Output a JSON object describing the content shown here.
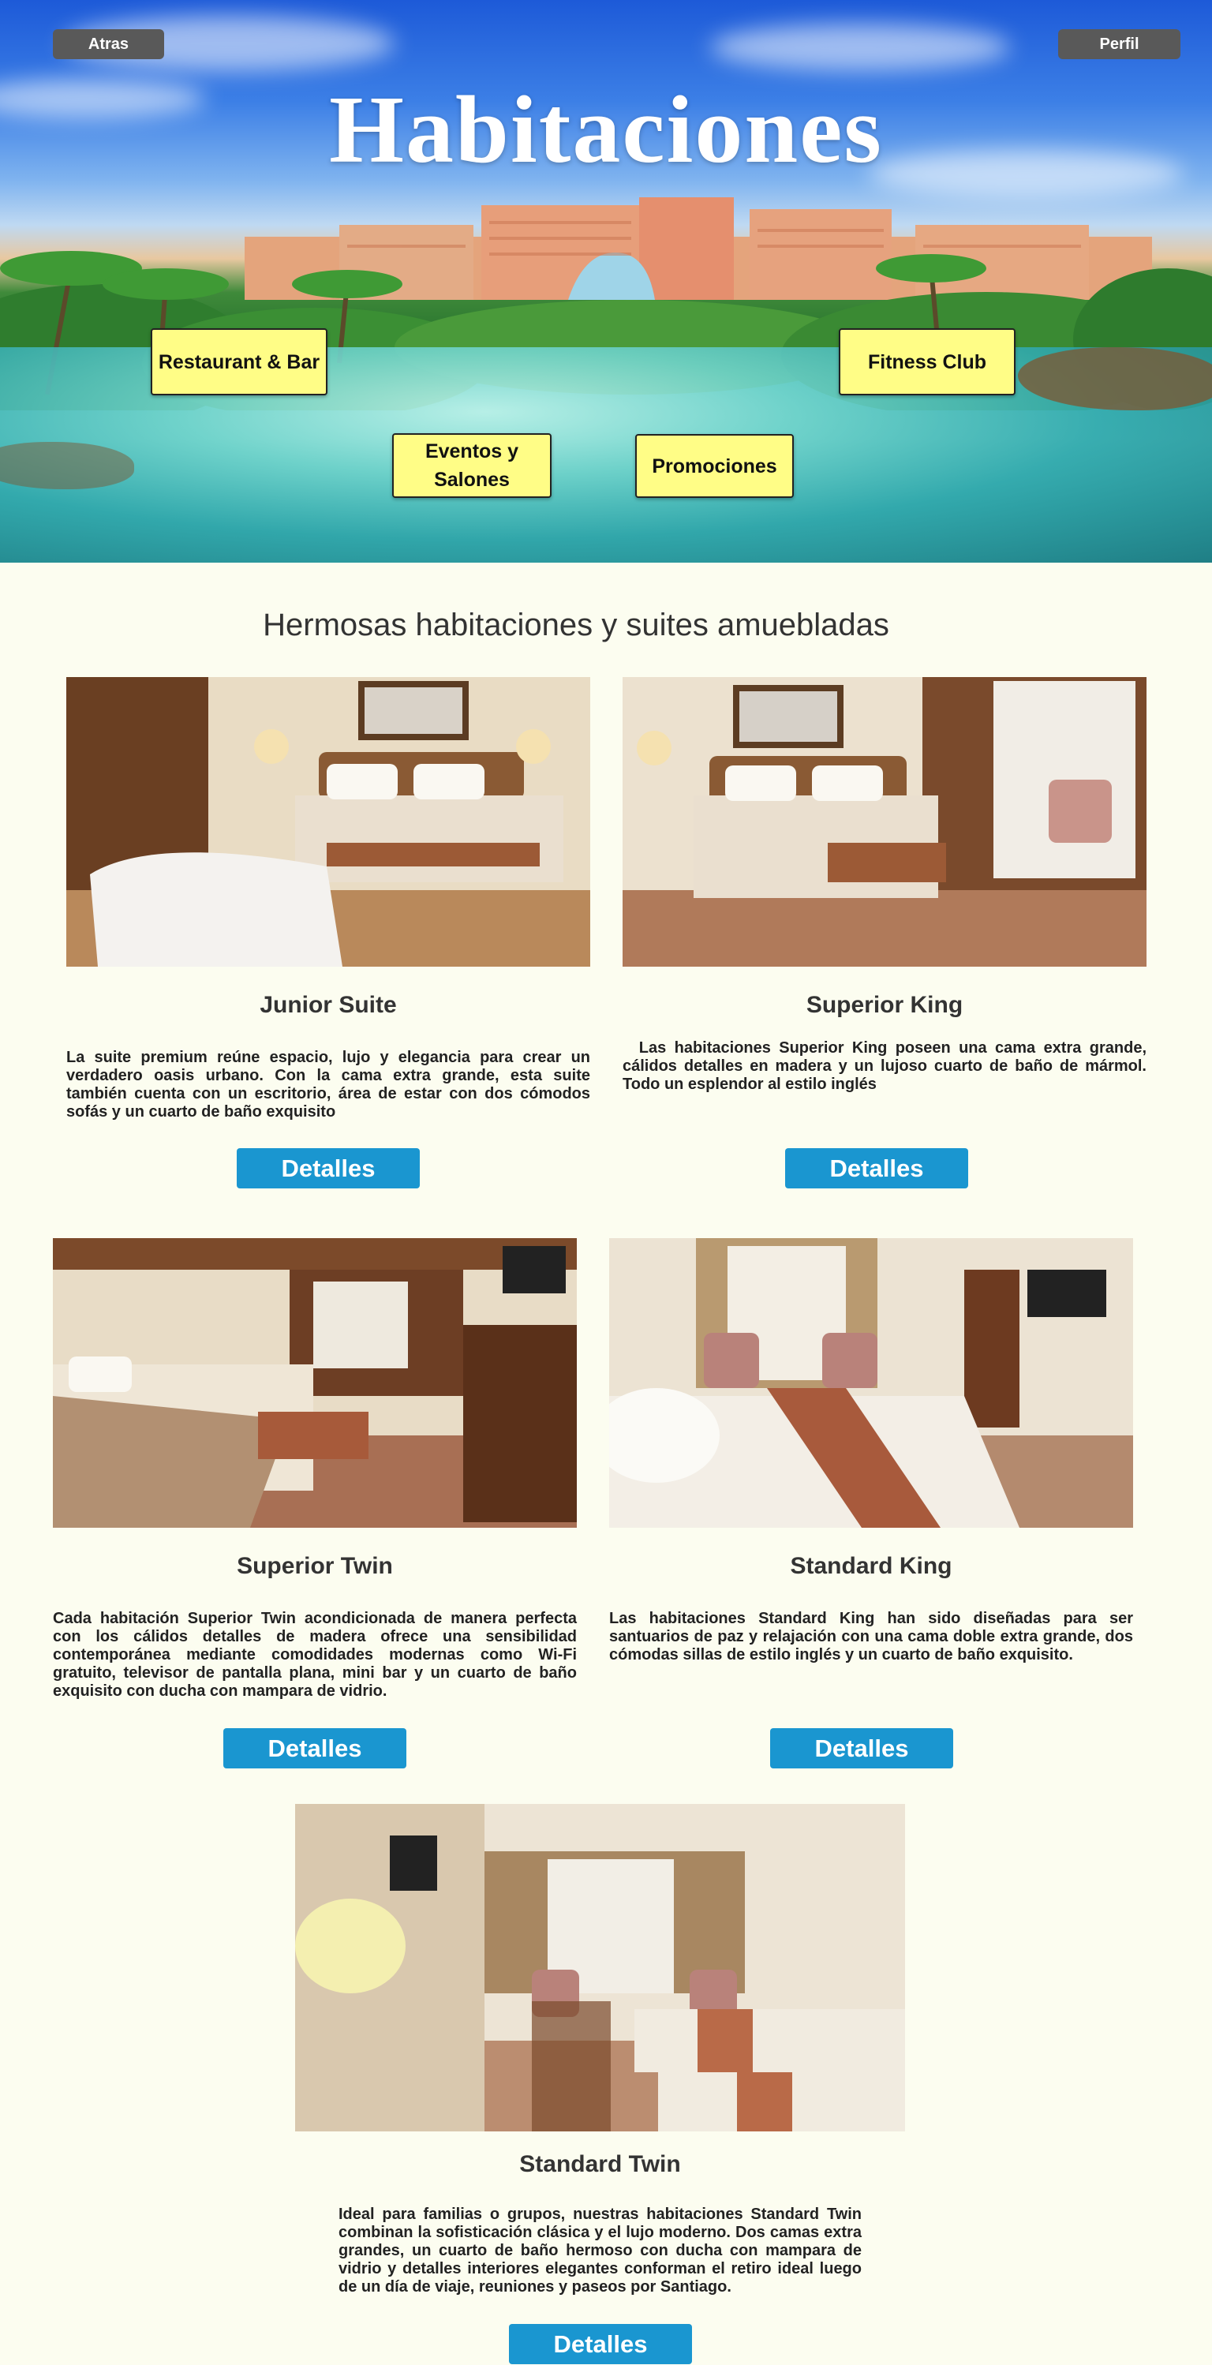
{
  "header": {
    "back_label": "Atras",
    "profile_label": "Perfil",
    "title": "Habitaciones"
  },
  "nav": [
    {
      "label": "Restaurant & Bar"
    },
    {
      "label": "Fitness Club"
    },
    {
      "label": "Eventos y Salones"
    },
    {
      "label": "Promociones"
    }
  ],
  "section_title": "Hermosas habitaciones y suites amuebladas",
  "rooms": [
    {
      "name": "Junior Suite",
      "description": "La suite premium reúne espacio, lujo y elegancia para crear un verdadero oasis urbano. Con la cama extra grande, esta suite también cuenta con un escritorio, área de estar con dos cómodos sofás y un cuarto de baño exquisito",
      "button": "Detalles"
    },
    {
      "name": "Superior King",
      "description": "  Las habitaciones Superior King poseen una cama extra grande, cálidos detalles en madera y un lujoso cuarto de baño de mármol. Todo un esplendor  al estilo inglés",
      "button": "Detalles"
    },
    {
      "name": "Superior Twin",
      "description": "Cada habitación Superior Twin acondicionada de manera perfecta con los cálidos detalles de madera ofrece una sensibilidad contemporánea mediante comodidades modernas como Wi-Fi gratuito, televisor de pantalla plana, mini bar y un cuarto de baño exquisito con ducha con mampara de vidrio.",
      "button": "Detalles"
    },
    {
      "name": "Standard King",
      "description": "Las habitaciones Standard King han sido diseñadas para ser santuarios de paz y relajación con una cama doble extra grande, dos cómodas sillas de estilo inglés y un cuarto de baño exquisito.",
      "button": "Detalles"
    },
    {
      "name": "Standard Twin",
      "description": "Ideal para familias o grupos, nuestras habitaciones Standard Twin combinan la sofisticación clásica y el lujo moderno. Dos camas extra grandes, un cuarto de baño hermoso con ducha con mampara de vidrio y detalles interiores elegantes conforman el retiro ideal luego de un día de viaje, reuniones y paseos por Santiago.",
      "button": "Detalles"
    }
  ],
  "colors": {
    "page_background": "#fcfdf0",
    "nav_box": "#fffd86",
    "detail_button": "#1a96d0",
    "top_button": "#595959"
  }
}
